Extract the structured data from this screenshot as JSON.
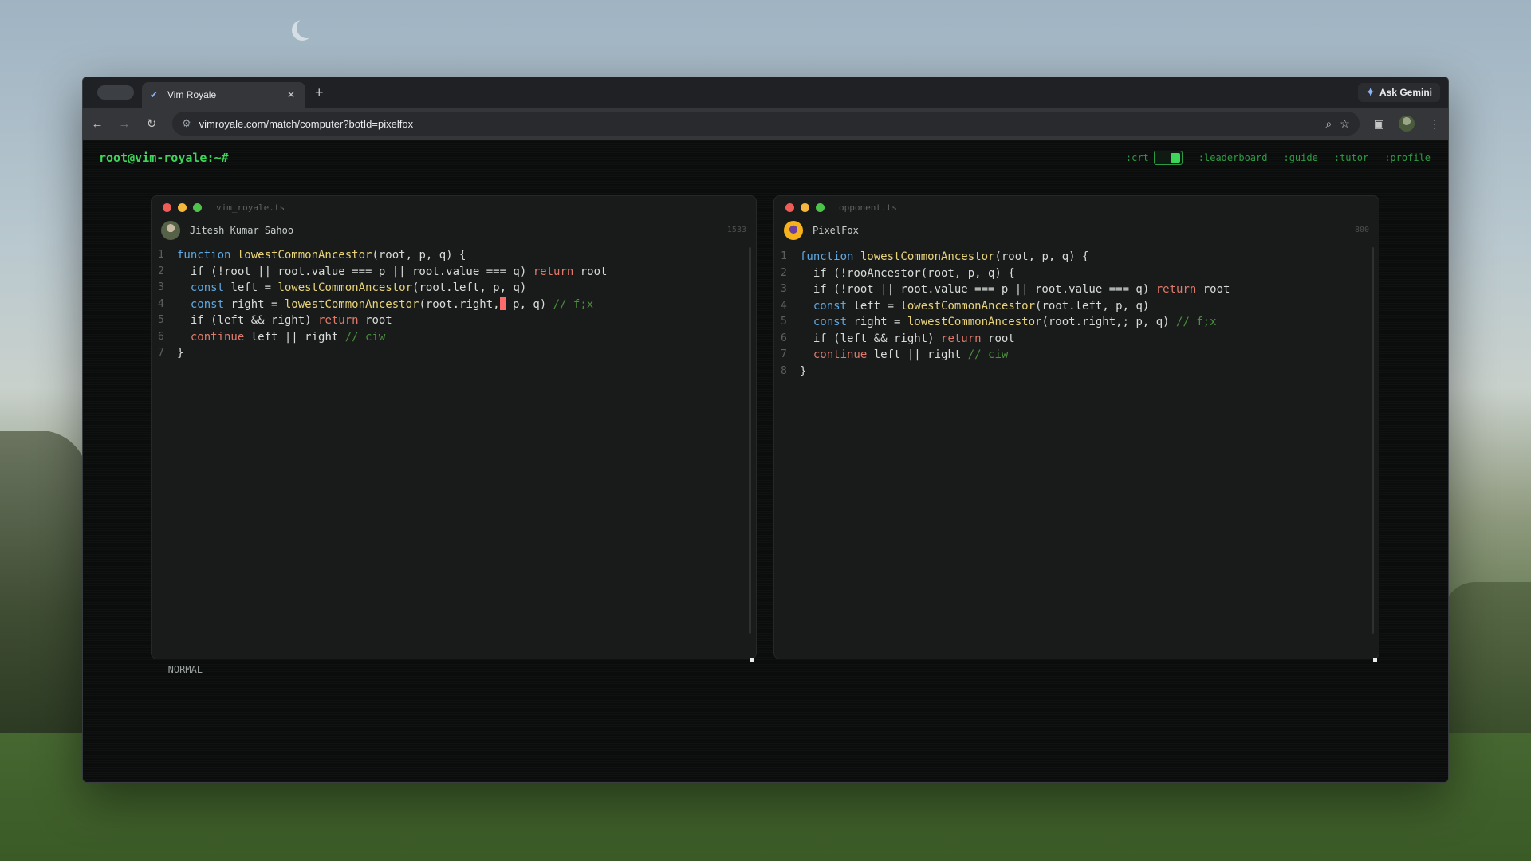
{
  "browser": {
    "tab_title": "Vim Royale",
    "url": "vimroyale.com/match/computer?botId=pixelfox",
    "ask_gemini": "Ask Gemini"
  },
  "app": {
    "prompt": "root@vim-royale:~#",
    "nav": {
      "crt": ":crt",
      "crt_on": true,
      "leaderboard": ":leaderboard",
      "guide": ":guide",
      "tutor": ":tutor",
      "profile": ":profile"
    },
    "mode": "-- NORMAL --"
  },
  "colors": {
    "accent_green": "#3fd45a",
    "keyword": "#5fa8e0",
    "return_keyword": "#e27a6c",
    "function_name": "#e8d37a",
    "comment": "#4a8f3d",
    "cursor": "#ff6b6b"
  },
  "player": {
    "filename": "vim_royale.ts",
    "name": "Jitesh Kumar Sahoo",
    "rating": "1533",
    "lines": [
      {
        "n": "1",
        "segs": [
          {
            "t": "function ",
            "c": "kw"
          },
          {
            "t": "lowestCommonAncestor",
            "c": "fn"
          },
          {
            "t": "(root, p, q) {",
            "c": ""
          }
        ]
      },
      {
        "n": "2",
        "segs": [
          {
            "t": "  if (!root || root.value === p || root.value === q) ",
            "c": ""
          },
          {
            "t": "return",
            "c": "kw2"
          },
          {
            "t": " root",
            "c": ""
          }
        ]
      },
      {
        "n": "3",
        "segs": [
          {
            "t": "  ",
            "c": ""
          },
          {
            "t": "const",
            "c": "kw"
          },
          {
            "t": " left = ",
            "c": ""
          },
          {
            "t": "lowestCommonAncestor",
            "c": "fn"
          },
          {
            "t": "(root.left, p, q)",
            "c": ""
          }
        ]
      },
      {
        "n": "4",
        "segs": [
          {
            "t": "  ",
            "c": ""
          },
          {
            "t": "const",
            "c": "kw"
          },
          {
            "t": " right = ",
            "c": ""
          },
          {
            "t": "lowestCommonAncestor",
            "c": "fn"
          },
          {
            "t": "(root.right,",
            "c": ""
          },
          {
            "t": "",
            "c": "cursor"
          },
          {
            "t": " p, q) ",
            "c": ""
          },
          {
            "t": "// f;x",
            "c": "cm"
          }
        ]
      },
      {
        "n": "5",
        "segs": [
          {
            "t": "  if (left && right) ",
            "c": ""
          },
          {
            "t": "return",
            "c": "kw2"
          },
          {
            "t": " root",
            "c": ""
          }
        ]
      },
      {
        "n": "6",
        "segs": [
          {
            "t": "  ",
            "c": ""
          },
          {
            "t": "continue",
            "c": "kw2"
          },
          {
            "t": " left || right ",
            "c": ""
          },
          {
            "t": "// ciw",
            "c": "cm"
          }
        ]
      },
      {
        "n": "7",
        "segs": [
          {
            "t": "}",
            "c": ""
          }
        ]
      }
    ]
  },
  "opponent": {
    "filename": "opponent.ts",
    "name": "PixelFox",
    "rating": "800",
    "lines": [
      {
        "n": "1",
        "segs": [
          {
            "t": "function ",
            "c": "kw"
          },
          {
            "t": "lowestCommonAncestor",
            "c": "fn"
          },
          {
            "t": "(root, p, q) {",
            "c": ""
          }
        ]
      },
      {
        "n": "2",
        "segs": [
          {
            "t": "  if (!rooAncestor(root, p, q) {",
            "c": ""
          }
        ]
      },
      {
        "n": "3",
        "segs": [
          {
            "t": "  if (!root || root.value === p || root.value === q) ",
            "c": ""
          },
          {
            "t": "return",
            "c": "kw2"
          },
          {
            "t": " root",
            "c": ""
          }
        ]
      },
      {
        "n": "4",
        "segs": [
          {
            "t": "  ",
            "c": ""
          },
          {
            "t": "const",
            "c": "kw"
          },
          {
            "t": " left = ",
            "c": ""
          },
          {
            "t": "lowestCommonAncestor",
            "c": "fn"
          },
          {
            "t": "(root.left, p, q)",
            "c": ""
          }
        ]
      },
      {
        "n": "5",
        "segs": [
          {
            "t": "  ",
            "c": ""
          },
          {
            "t": "const",
            "c": "kw"
          },
          {
            "t": " right = ",
            "c": ""
          },
          {
            "t": "lowestCommonAncestor",
            "c": "fn"
          },
          {
            "t": "(root.right,; p, q) ",
            "c": ""
          },
          {
            "t": "// f;x",
            "c": "cm"
          }
        ]
      },
      {
        "n": "6",
        "segs": [
          {
            "t": "  if (left && right) ",
            "c": ""
          },
          {
            "t": "return",
            "c": "kw2"
          },
          {
            "t": " root",
            "c": ""
          }
        ]
      },
      {
        "n": "7",
        "segs": [
          {
            "t": "  ",
            "c": ""
          },
          {
            "t": "continue",
            "c": "kw2"
          },
          {
            "t": " left || right ",
            "c": ""
          },
          {
            "t": "// ciw",
            "c": "cm"
          }
        ]
      },
      {
        "n": "8",
        "segs": [
          {
            "t": "}",
            "c": ""
          }
        ]
      }
    ]
  }
}
